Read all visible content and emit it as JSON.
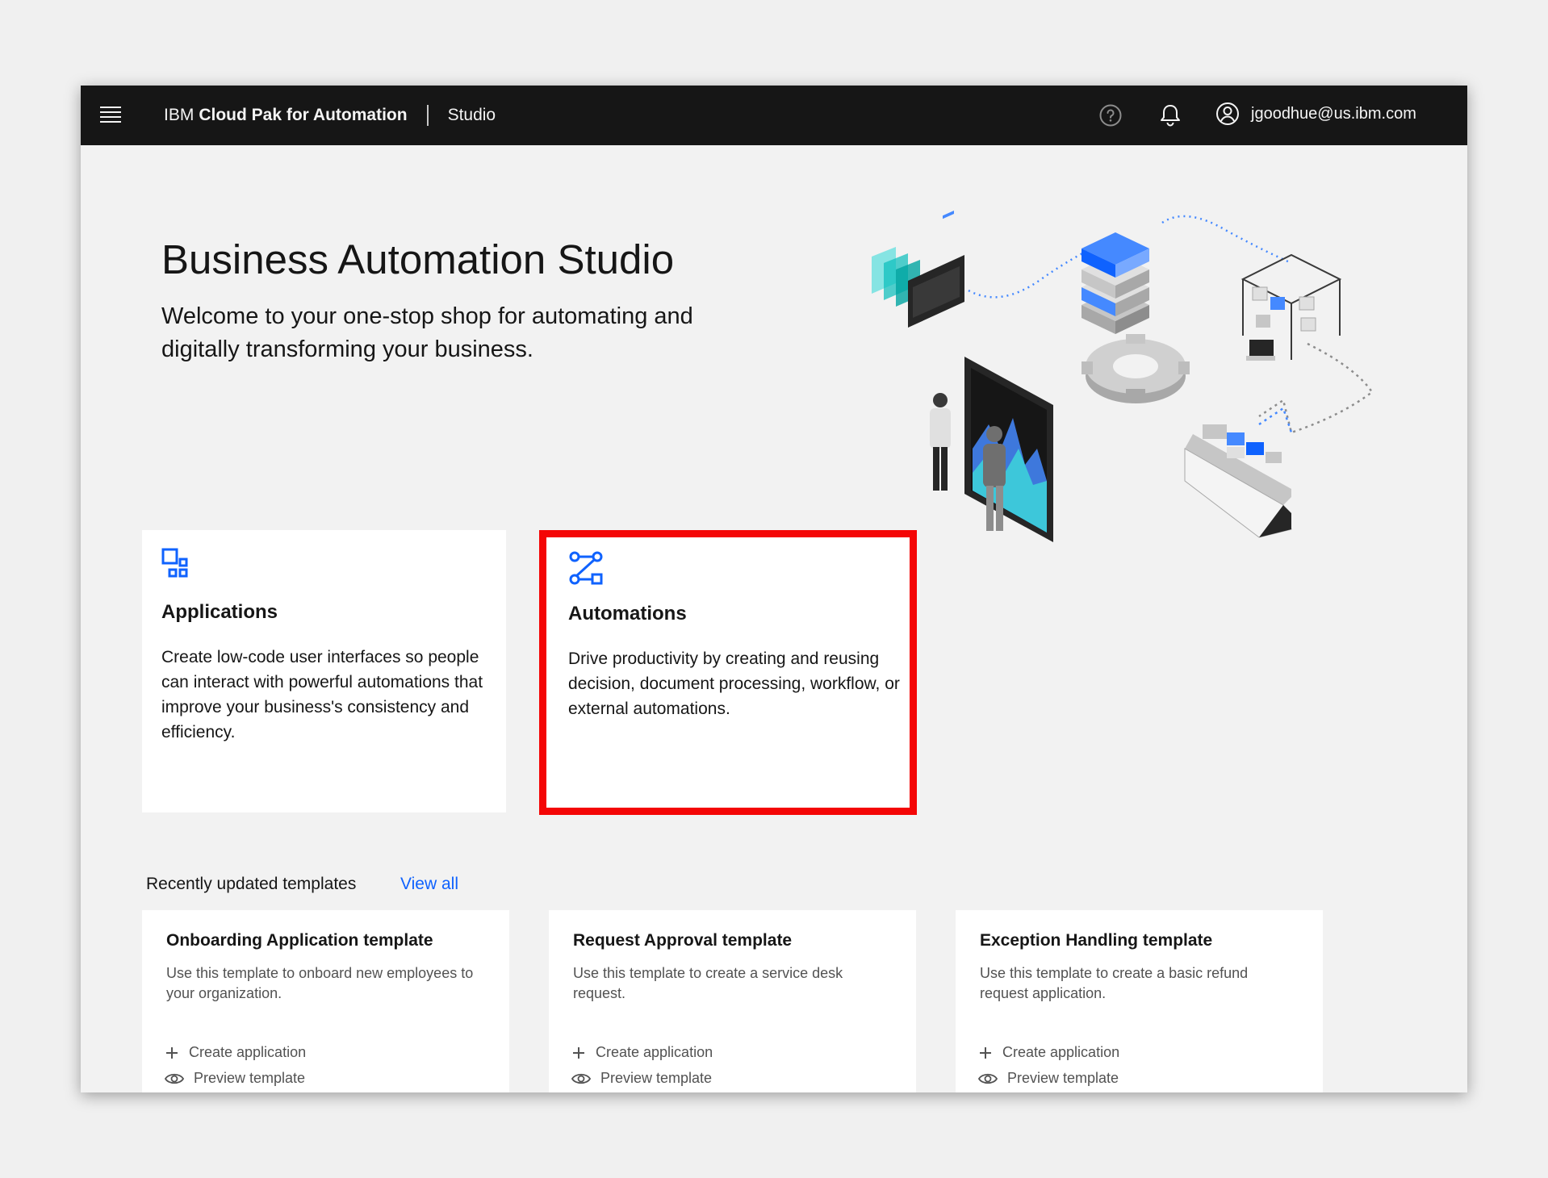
{
  "header": {
    "brand_prefix": "IBM",
    "brand_name": "Cloud Pak for Automation",
    "product": "Studio",
    "user_email": "jgoodhue@us.ibm.com"
  },
  "hero": {
    "title": "Business Automation Studio",
    "subtitle": "Welcome to your one-stop shop for automating and digitally transforming your business."
  },
  "tiles": [
    {
      "title": "Applications",
      "description": "Create low-code user interfaces so people can interact with powerful automations that improve your business's consistency and efficiency."
    },
    {
      "title": "Automations",
      "description": "Drive productivity by creating and reusing decision, document processing, workflow, or external automations."
    }
  ],
  "recent": {
    "title": "Recently updated templates",
    "view_all": "View all",
    "templates": [
      {
        "title": "Onboarding Application template",
        "description": "Use this template to onboard new employees to your organization.",
        "create_label": "Create application",
        "preview_label": "Preview template"
      },
      {
        "title": "Request Approval template",
        "description": "Use this template to create a service desk request.",
        "create_label": "Create application",
        "preview_label": "Preview template"
      },
      {
        "title": "Exception Handling template",
        "description": "Use this template to create a basic refund request application.",
        "create_label": "Create application",
        "preview_label": "Preview template"
      }
    ]
  },
  "colors": {
    "header_bg": "#161616",
    "accent_blue": "#0f62fe",
    "highlight_red": "#f40606"
  },
  "icons": [
    "menu-icon",
    "help-icon",
    "notification-icon",
    "user-avatar-icon",
    "applications-icon",
    "automations-icon",
    "add-icon",
    "view-icon"
  ]
}
